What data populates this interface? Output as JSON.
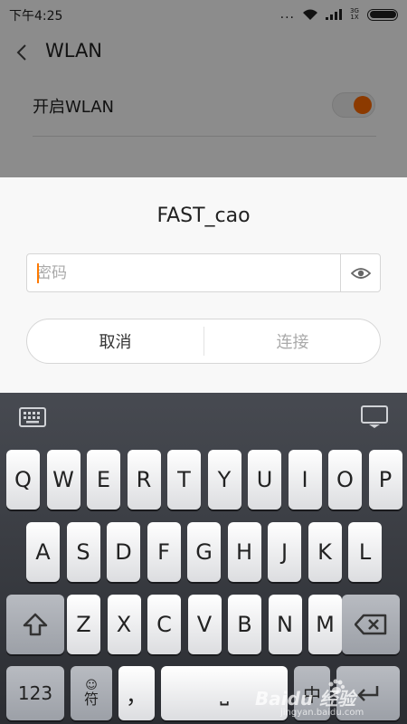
{
  "status_bar": {
    "time": "下午4:25",
    "dots": "...",
    "network_label": "3G 1X"
  },
  "nav": {
    "title": "WLAN"
  },
  "settings": {
    "wlan_label": "开启WLAN",
    "wlan_enabled": true
  },
  "dialog": {
    "title": "FAST_cao",
    "password_value": "",
    "password_placeholder": "密码",
    "cancel_label": "取消",
    "connect_label": "连接"
  },
  "keyboard": {
    "row1": [
      "Q",
      "W",
      "E",
      "R",
      "T",
      "Y",
      "U",
      "I",
      "O",
      "P"
    ],
    "row2": [
      "A",
      "S",
      "D",
      "F",
      "G",
      "H",
      "J",
      "K",
      "L"
    ],
    "row3": [
      "Z",
      "X",
      "C",
      "V",
      "B",
      "N",
      "M"
    ],
    "numbers_label": "123",
    "symbols_label": "符",
    "symbols_emoji": "☺",
    "comma_label": "，",
    "space_label": "⎵",
    "chinese_label": "中"
  },
  "watermark": {
    "text": "Baidu 经验",
    "url": "jingyan.baidu.com"
  },
  "colors": {
    "accent": "#ff6a00",
    "keyboard_bg": "#3a3c42",
    "dialog_bg": "#f8f8f8"
  }
}
